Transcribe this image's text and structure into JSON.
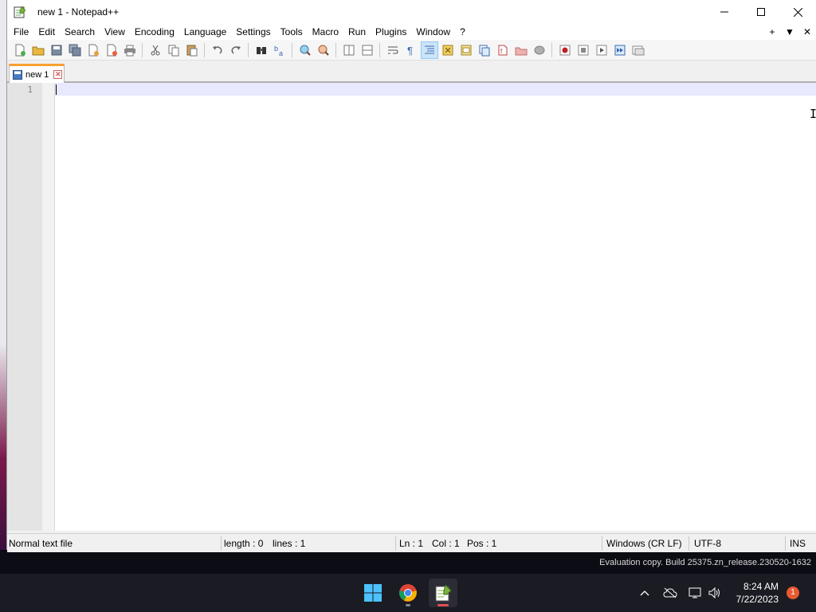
{
  "window": {
    "title": "new 1 - Notepad++",
    "controls": {
      "minimize": "—",
      "maximize": "☐",
      "close": "✕"
    }
  },
  "menu": {
    "items": [
      "File",
      "Edit",
      "Search",
      "View",
      "Encoding",
      "Language",
      "Settings",
      "Tools",
      "Macro",
      "Run",
      "Plugins",
      "Window",
      "?"
    ],
    "right": {
      "add": "+",
      "dropdown": "▼",
      "close": "✕"
    }
  },
  "toolbar": {
    "icons": [
      "new-file-icon",
      "open-file-icon",
      "save-icon",
      "save-all-icon",
      "close-icon",
      "close-all-icon",
      "print-icon",
      "cut-icon",
      "copy-icon",
      "paste-icon",
      "undo-icon",
      "redo-icon",
      "find-icon",
      "replace-icon",
      "zoom-in-icon",
      "zoom-out-icon",
      "sync-vertical-icon",
      "sync-horizontal-icon",
      "word-wrap-icon",
      "show-all-characters-icon",
      "indent-guide-icon",
      "udl-icon",
      "doc-map-icon",
      "function-list-icon",
      "folder-as-workspace-icon",
      "doc-list-icon",
      "monitoring-icon",
      "record-macro-icon",
      "stop-macro-icon",
      "play-macro-icon",
      "run-macro-multiple-icon",
      "save-macro-icon"
    ]
  },
  "tabs": [
    {
      "label": "new 1",
      "close": "✕"
    }
  ],
  "editor": {
    "line_numbers": [
      "1"
    ],
    "content": ""
  },
  "status": {
    "file_type": "Normal text file",
    "length": "length : 0",
    "lines": "lines : 1",
    "ln": "Ln : 1",
    "col": "Col : 1",
    "pos": "Pos : 1",
    "eol": "Windows (CR LF)",
    "encoding": "UTF-8",
    "mode": "INS"
  },
  "evaluation": "Evaluation copy. Build 25375.zn_release.230520-1632",
  "taskbar": {
    "apps": [
      "windows-start-icon",
      "chrome-icon",
      "notepadpp-icon"
    ],
    "clock_time": "8:24 AM",
    "clock_date": "7/22/2023",
    "notification_count": "1"
  },
  "colors": {
    "tab_accent": "#f8a030",
    "current_line": "#e8e8ff",
    "taskbar": "#1b1b23"
  }
}
